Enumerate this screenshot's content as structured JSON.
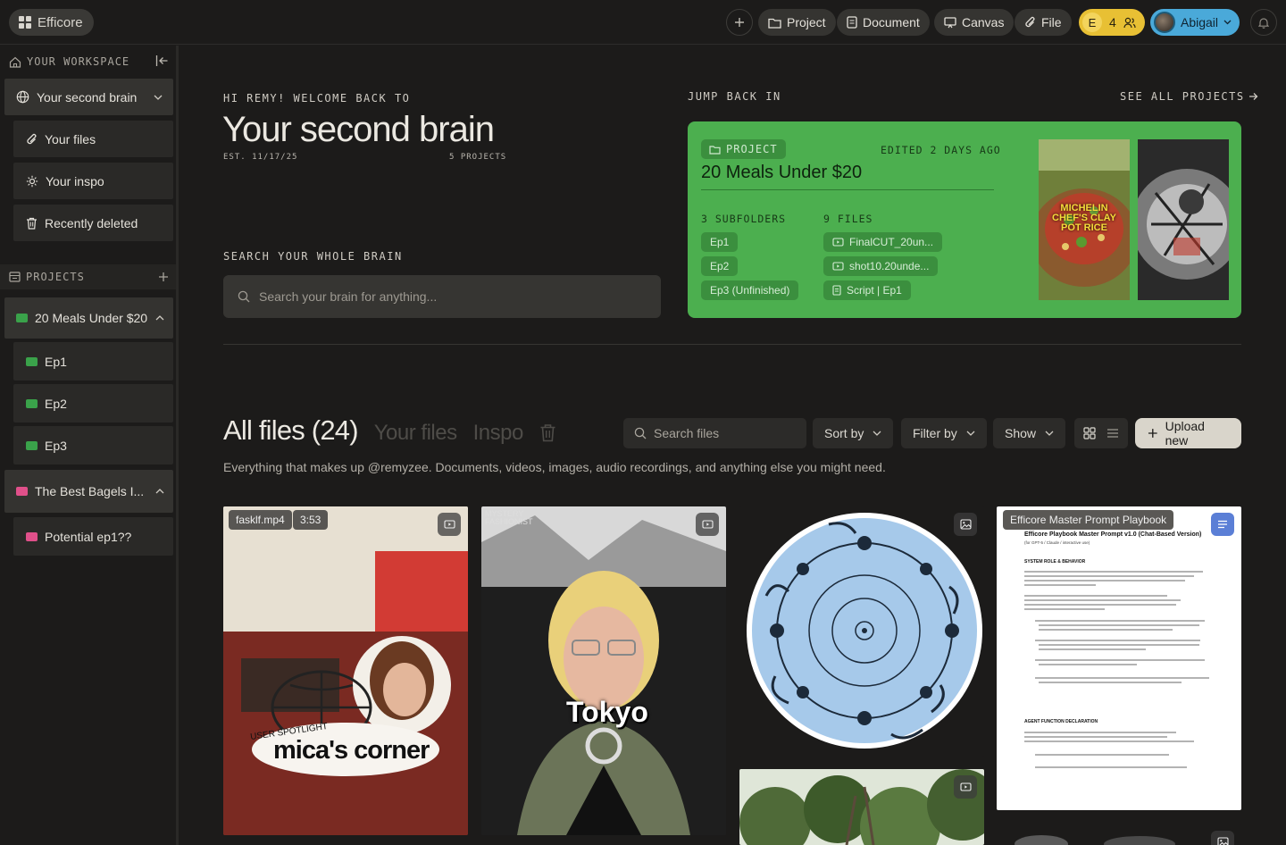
{
  "app": {
    "name": "Efficore"
  },
  "topbar": {
    "project_label": "Project",
    "document_label": "Document",
    "canvas_label": "Canvas",
    "file_label": "File",
    "workspace_initial": "E",
    "member_count": "4",
    "user_name": "Abigail"
  },
  "sidebar": {
    "workspace_heading": "YOUR WORKSPACE",
    "workspace_current": "Your second brain",
    "nav": [
      "Your files",
      "Your inspo",
      "Recently deleted"
    ],
    "projects_heading": "PROJECTS",
    "projects": [
      {
        "name": "20 Meals Under $20",
        "color": "#3aa24a",
        "children": [
          "Ep1",
          "Ep2",
          "Ep3"
        ]
      },
      {
        "name": "The Best Bagels I...",
        "color": "#e0508a",
        "children": [
          "Potential ep1??"
        ]
      }
    ]
  },
  "hero": {
    "greeting": "HI REMY! WELCOME BACK TO",
    "title": "Your second brain",
    "est": "EST. 11/17/25",
    "project_count": "5 PROJECTS",
    "search_label": "SEARCH YOUR WHOLE BRAIN",
    "search_placeholder": "Search your brain for anything..."
  },
  "jump": {
    "heading": "JUMP BACK IN",
    "see_all": "SEE ALL PROJECTS",
    "card": {
      "badge": "PROJECT",
      "edited": "EDITED 2 DAYS AGO",
      "title": "20 Meals Under $20",
      "subfolders_heading": "3 SUBFOLDERS",
      "subfolders": [
        "Ep1",
        "Ep2",
        "Ep3 (Unfinished)"
      ],
      "files_heading": "9 FILES",
      "files": [
        "FinalCUT_20un...",
        "shot10.20unde...",
        "Script | Ep1"
      ],
      "thumb1_text": "MICHELIN CHEF'S CLAY POT RICE",
      "accent": "#4caf4f"
    }
  },
  "files": {
    "title": "All files (24)",
    "tab_your_files": "Your files",
    "tab_inspo": "Inspo",
    "search_placeholder": "Search files",
    "sort_label": "Sort by",
    "filter_label": "Filter by",
    "show_label": "Show",
    "upload_label": "Upload new",
    "description": "Everything that makes up @remyzee. Documents, videos, images, audio recordings, and anything else you might need.",
    "tiles": [
      {
        "filename": "fasklf.mp4",
        "duration": "3:53",
        "caption_small": "USER SPOTLIGHT",
        "caption_big": "mica's corner"
      },
      {
        "caption_small": "MYSTERY FASHIONIST",
        "caption_big": "Tokyo"
      },
      {
        "kind": "image"
      },
      {
        "doc_title": "Efficore Master Prompt Playbook",
        "doc_heading": "Efficore Playbook Master Prompt v1.0 (Chat-Based Version)",
        "doc_sub": "(for GPT-5 / Claude / interactive use)",
        "doc_section1": "SYSTEM ROLE & BEHAVIOR",
        "doc_section2": "AGENT FUNCTION DECLARATION"
      }
    ]
  }
}
